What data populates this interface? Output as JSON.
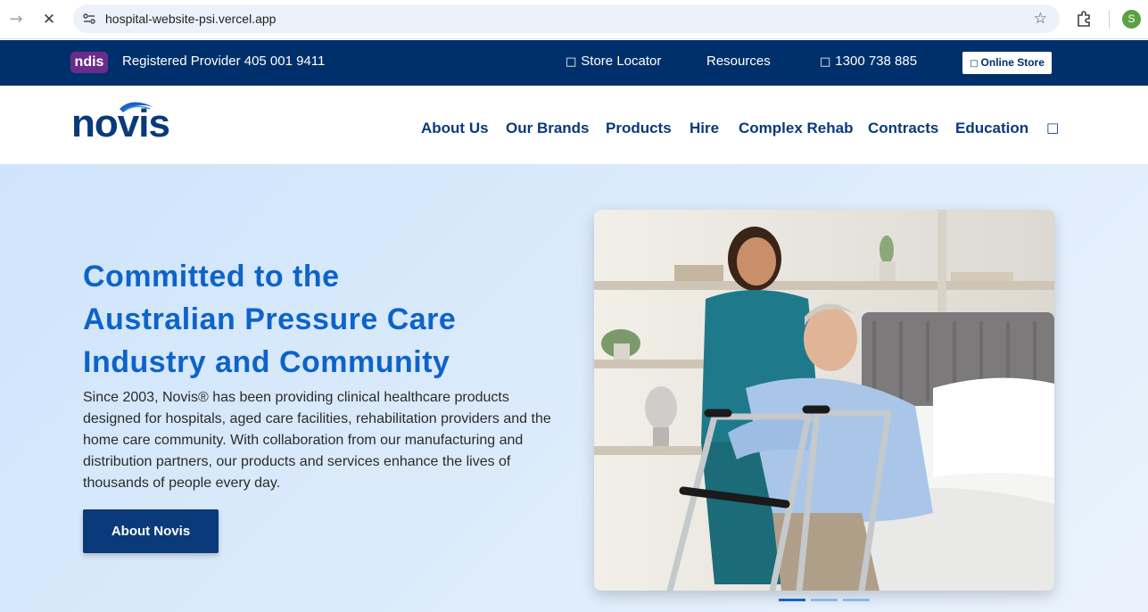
{
  "browser": {
    "url": "hospital-website-psi.vercel.app",
    "profile_initial": "S"
  },
  "topbar": {
    "ndis_label": "ndis",
    "registered": "Registered Provider 405 001 9411",
    "store_locator": "Store Locator",
    "resources": "Resources",
    "phone": "1300 738 885",
    "online_store": "Online Store",
    "icon_glyph": "□",
    "colors": {
      "bar": "#00306b",
      "ndis": "#6a2c8a"
    }
  },
  "header": {
    "logo": "novis",
    "nav": [
      "About Us",
      "Our Brands",
      "Products",
      "Hire",
      "Complex Rehab",
      "Contracts",
      "Education"
    ],
    "search_glyph": "□"
  },
  "hero": {
    "title_line1": "Committed to the",
    "title_line2": "Australian Pressure Care",
    "title_line3": "Industry and Community",
    "description": "Since 2003, Novis® has been providing clinical healthcare products designed for hospitals, aged care facilities, rehabilitation providers and the home care community. With collaboration from our manufacturing and distribution partners, our products and services enhance the lives of thousands of people every day.",
    "button": "About Novis",
    "slides": 3,
    "active_slide": 1,
    "colors": {
      "brand": "#0a3a7a",
      "accent": "#0d63c9"
    }
  }
}
